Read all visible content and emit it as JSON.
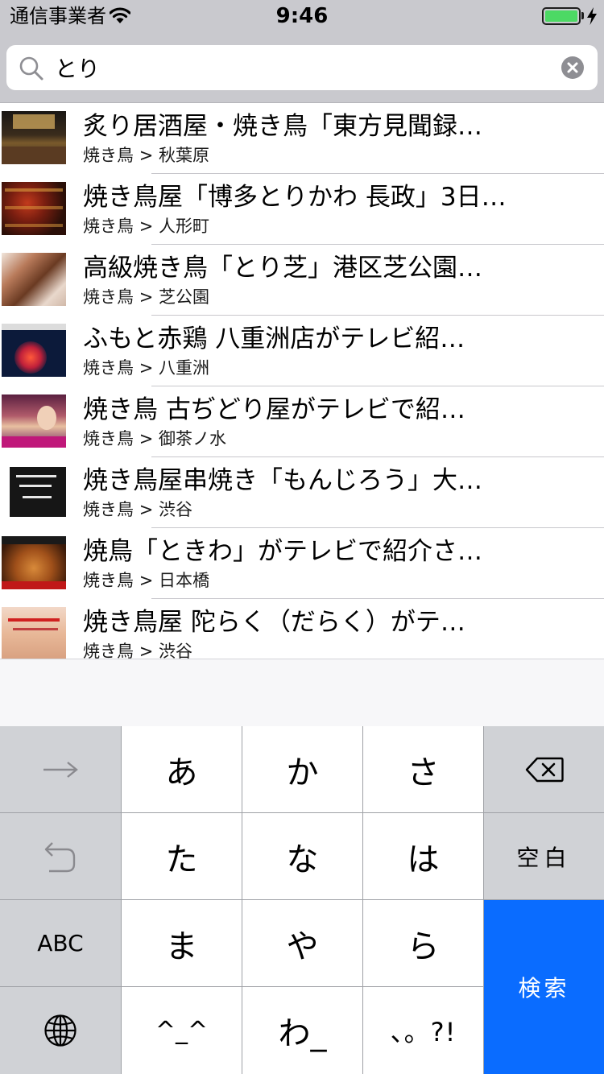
{
  "status_bar": {
    "carrier": "通信事業者",
    "time": "9:46",
    "battery_level": 1.0,
    "battery_color": "#4cd964",
    "icons": [
      "wifi-icon",
      "battery-icon",
      "charging-bolt-icon"
    ]
  },
  "search": {
    "value": "とり",
    "placeholder": "",
    "icons": [
      "search-icon",
      "clear-icon"
    ]
  },
  "results": [
    {
      "title": "炙り居酒屋・焼き鳥「東方見聞録…",
      "category": "焼き鳥",
      "separator": ">",
      "area": "秋葉原"
    },
    {
      "title": "焼き鳥屋「博多とりかわ 長政」3日…",
      "category": "焼き鳥",
      "separator": ">",
      "area": "人形町"
    },
    {
      "title": "高級焼き鳥「とり芝」港区芝公園…",
      "category": "焼き鳥",
      "separator": ">",
      "area": "芝公園"
    },
    {
      "title": "ふもと赤鶏 八重洲店がテレビ紹…",
      "category": "焼き鳥",
      "separator": ">",
      "area": "八重洲"
    },
    {
      "title": "焼き鳥 古ぢどり屋がテレビで紹…",
      "category": "焼き鳥",
      "separator": ">",
      "area": "御茶ノ水"
    },
    {
      "title": "焼き鳥屋串焼き「もんじろう」大…",
      "category": "焼き鳥",
      "separator": ">",
      "area": "渋谷"
    },
    {
      "title": "焼鳥「ときわ」がテレビで紹介さ…",
      "category": "焼き鳥",
      "separator": ">",
      "area": "日本橋"
    },
    {
      "title": "焼き鳥屋 陀らく（だらく）がテ…",
      "category": "焼き鳥",
      "separator": ">",
      "area": "渋谷"
    }
  ],
  "keyboard": {
    "keys": {
      "a": "あ",
      "ka": "か",
      "sa": "さ",
      "ta": "た",
      "na": "な",
      "ha": "は",
      "ma": "ま",
      "ya": "や",
      "ra": "ら",
      "emoticon": "^_^",
      "wa": "わ_",
      "punct": "、。?!",
      "space": "空白",
      "abc": "ABC",
      "search": "検索"
    },
    "icons": [
      "arrow-right-icon",
      "backspace-icon",
      "undo-icon",
      "globe-icon"
    ],
    "accent": "#0a6cff"
  }
}
